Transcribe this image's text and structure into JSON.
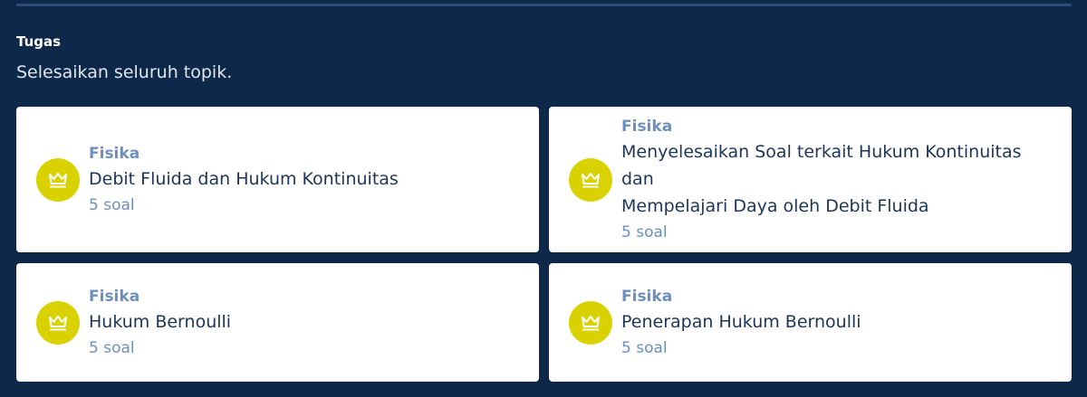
{
  "section": {
    "title": "Tugas",
    "subtitle": "Selesaikan seluruh topik."
  },
  "colors": {
    "background": "#0d2849",
    "card": "#ffffff",
    "icon_circle": "#d9d200",
    "subject_text": "#6d8fbd",
    "topic_text": "#1d3557"
  },
  "cards": [
    {
      "icon": "crown-icon",
      "subject": "Fisika",
      "topic_line1": "Debit Fluida dan Hukum Kontinuitas",
      "topic_line2": "",
      "count": "5 soal"
    },
    {
      "icon": "crown-icon",
      "subject": "Fisika",
      "topic_line1": "Menyelesaikan Soal terkait Hukum Kontinuitas dan",
      "topic_line2": "Mempelajari Daya oleh Debit Fluida",
      "count": "5 soal"
    },
    {
      "icon": "crown-icon",
      "subject": "Fisika",
      "topic_line1": "Hukum Bernoulli",
      "topic_line2": "",
      "count": "5 soal"
    },
    {
      "icon": "crown-icon",
      "subject": "Fisika",
      "topic_line1": "Penerapan Hukum Bernoulli",
      "topic_line2": "",
      "count": "5 soal"
    }
  ]
}
